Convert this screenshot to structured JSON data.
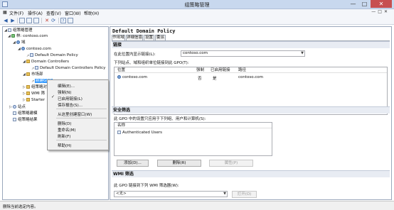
{
  "window": {
    "title": "组策略管理"
  },
  "menu": {
    "items": [
      "文件(F)",
      "操作(A)",
      "查看(V)",
      "窗口(W)",
      "帮助(H)"
    ]
  },
  "tree": {
    "root": "组策略管理",
    "forest": "林: contoso.com",
    "domains": "域",
    "domain": "contoso.com",
    "default_policy": "Default Domain Policy",
    "dc_ou": "Domain Controllers",
    "dc_policy": "Default Domain Controllers Policy",
    "market_ou": "市场部",
    "selected_gpo": "新建GPO",
    "gpo_objects": "组策略对象",
    "wmi": "WMI 筛",
    "starter": "Starter",
    "sites": "站点",
    "modeling": "组策略建模",
    "results": "组策略结果"
  },
  "context_menu": {
    "items": [
      "编辑(E)...",
      "强制(N)",
      "已启用链接(L)",
      "保存报告(S)...",
      "从这里创建窗口(W)",
      "删除(D)",
      "重命名(M)",
      "刷新(F)",
      "帮助(H)"
    ],
    "checked_item": "已启用链接(L)"
  },
  "detail": {
    "title": "Default Domain Policy",
    "tabs": [
      "作用域",
      "详细信息",
      "设置",
      "委派"
    ],
    "active_tab": "作用域",
    "links": {
      "heading": "链接",
      "show_label": "在此位置内显示链接(L):",
      "location_value": "contoso.com",
      "desc": "下列站点、域和组织单位链接到此 GPO(T):",
      "columns": [
        "位置",
        "强制",
        "已启用链接",
        "路径"
      ],
      "row": {
        "location": "contoso.com",
        "enforced": "否",
        "enabled": "是",
        "path": "contoso.com"
      }
    },
    "security": {
      "heading": "安全筛选",
      "desc": "此 GPO 中的设置只应用于下列组、用户和计算机(S):",
      "column": "名称",
      "row": "Authenticated Users",
      "add_button": "添加(D)...",
      "remove_button": "删除(R)",
      "properties_button": "属性(P)"
    },
    "wmi": {
      "heading": "WMI 筛选",
      "desc": "此 GPO 链接到下列 WMI 筛选器(W):",
      "value": "<无>",
      "open_button": "打开(O)"
    }
  },
  "status": {
    "text": "删除当前选定内容。"
  },
  "colors": {
    "selection": "#3399ff",
    "title_bar": "#c8d8ee",
    "close_button": "#c75050"
  }
}
